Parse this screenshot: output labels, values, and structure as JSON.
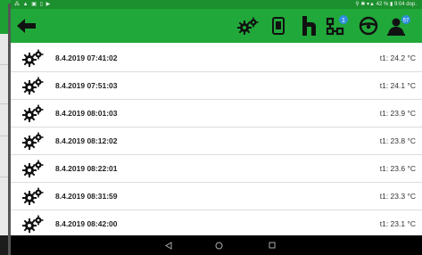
{
  "status_bar": {
    "left_icons": [
      "signal-icon",
      "warning-icon",
      "image-icon",
      "sim-icon",
      "play-icon"
    ],
    "right_text": "⚲ ✱ ▾▲ 42 % ▮ 9:04 dop."
  },
  "toolbar": {
    "badge_count_4": "1",
    "badge_count_6": "57"
  },
  "records": [
    {
      "timestamp": "8.4.2019 07:41:02",
      "value": "t1: 24.2 °C"
    },
    {
      "timestamp": "8.4.2019 07:51:03",
      "value": "t1: 24.1 °C"
    },
    {
      "timestamp": "8.4.2019 08:01:03",
      "value": "t1: 23.9 °C"
    },
    {
      "timestamp": "8.4.2019 08:12:02",
      "value": "t1: 23.8 °C"
    },
    {
      "timestamp": "8.4.2019 08:22:01",
      "value": "t1: 23.6 °C"
    },
    {
      "timestamp": "8.4.2019 08:31:59",
      "value": "t1: 23.3 °C"
    },
    {
      "timestamp": "8.4.2019 08:42:00",
      "value": "t1: 23.1 °C"
    }
  ],
  "colors": {
    "toolbar": "#21a83a",
    "status_bar": "#1c8f2e",
    "badge": "#2f8fe0"
  }
}
